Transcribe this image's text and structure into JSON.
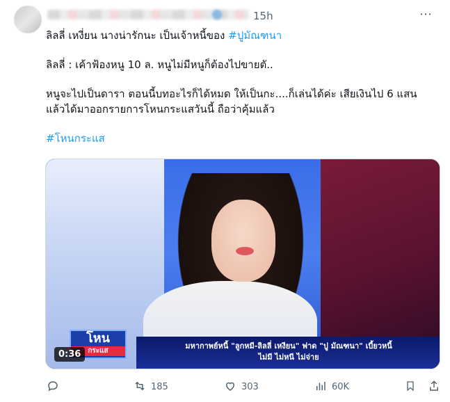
{
  "header": {
    "time": "15h",
    "more_icon": "more-horizontal-icon"
  },
  "tweet": {
    "line1_text": "ลิลลี่ เหงี่ยน นางน่ารักนะ เป็นเจ้าหนี้ของ ",
    "line1_hashtag": "#ปูมัณฑนา",
    "line2": "ลิลลี่ : เค้าฟ้องหนู 10 ล. หนูไม่มีหนูก็ต้องไปขายตั..",
    "line3": "หนูจะไปเป็นดารา ตอนนี้บทอะไรก็ได้หมด ให้เป็นกะ....ก็เล่นได้ค่ะ เสียเงินไป 6 แสน",
    "line4": "แล้วได้มาออกรายการโหนกระแสวันนี้ ถือว่าคุ้มแล้ว",
    "hashtag2": "#โหนกระแส"
  },
  "media": {
    "logo_main": "โหน",
    "logo_sub": "กระแส",
    "banner_line1": "มหากาพย์หนี้ \"ลูกหมี-ลิลลี่ เหงียน\" ฟาด \"ปู มัณฑนา\" เบี้ยวหนี้",
    "banner_line2": "ไม่มี ไม่หนี ไม่จ่าย",
    "duration": "0:36"
  },
  "actions": {
    "reply_count": "",
    "retweet_count": "185",
    "like_count": "303",
    "views_count": "60K"
  }
}
